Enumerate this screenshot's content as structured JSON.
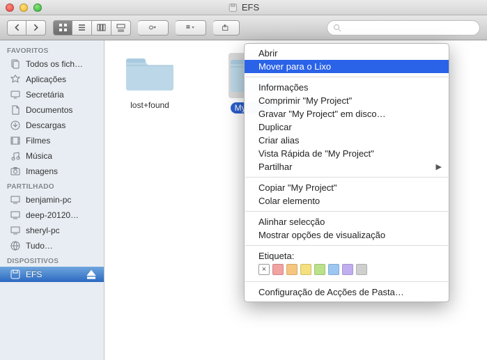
{
  "window": {
    "title": "EFS"
  },
  "sidebar": {
    "sections": [
      {
        "header": "FAVORITOS",
        "items": [
          {
            "label": "Todos os fich…",
            "icon": "all-files"
          },
          {
            "label": "Aplicações",
            "icon": "apps"
          },
          {
            "label": "Secretária",
            "icon": "desktop"
          },
          {
            "label": "Documentos",
            "icon": "documents"
          },
          {
            "label": "Descargas",
            "icon": "downloads"
          },
          {
            "label": "Filmes",
            "icon": "movies"
          },
          {
            "label": "Música",
            "icon": "music"
          },
          {
            "label": "Imagens",
            "icon": "pictures"
          }
        ]
      },
      {
        "header": "PARTILHADO",
        "items": [
          {
            "label": "benjamin-pc",
            "icon": "pc"
          },
          {
            "label": "deep-20120…",
            "icon": "pc"
          },
          {
            "label": "sheryl-pc",
            "icon": "pc"
          },
          {
            "label": "Tudo…",
            "icon": "network"
          }
        ]
      },
      {
        "header": "DISPOSITIVOS",
        "items": [
          {
            "label": "EFS",
            "icon": "disk",
            "selected": true,
            "eject": true
          }
        ]
      }
    ]
  },
  "content": {
    "items": [
      {
        "name": "lost+found",
        "selected": false
      },
      {
        "name": "My Project",
        "selected": true
      }
    ]
  },
  "context_menu": {
    "groups": [
      [
        {
          "label": "Abrir"
        },
        {
          "label": "Mover para o Lixo",
          "highlighted": true
        }
      ],
      [
        {
          "label": "Informações"
        },
        {
          "label": "Comprimir \"My Project\""
        },
        {
          "label": "Gravar \"My Project\" em disco…"
        },
        {
          "label": "Duplicar"
        },
        {
          "label": "Criar alias"
        },
        {
          "label": "Vista Rápida de \"My Project\""
        },
        {
          "label": "Partilhar",
          "submenu": true
        }
      ],
      [
        {
          "label": "Copiar \"My Project\""
        },
        {
          "label": "Colar elemento"
        }
      ],
      [
        {
          "label": "Alinhar selecção"
        },
        {
          "label": "Mostrar opções de visualização"
        }
      ]
    ],
    "label_header": "Etiqueta:",
    "swatches": [
      "x",
      "#f2a2a0",
      "#f6c67e",
      "#f5e07e",
      "#b9e28a",
      "#9cc7f3",
      "#c1aef0",
      "#cfcfcf"
    ],
    "footer": "Configuração de Acções de Pasta…"
  }
}
